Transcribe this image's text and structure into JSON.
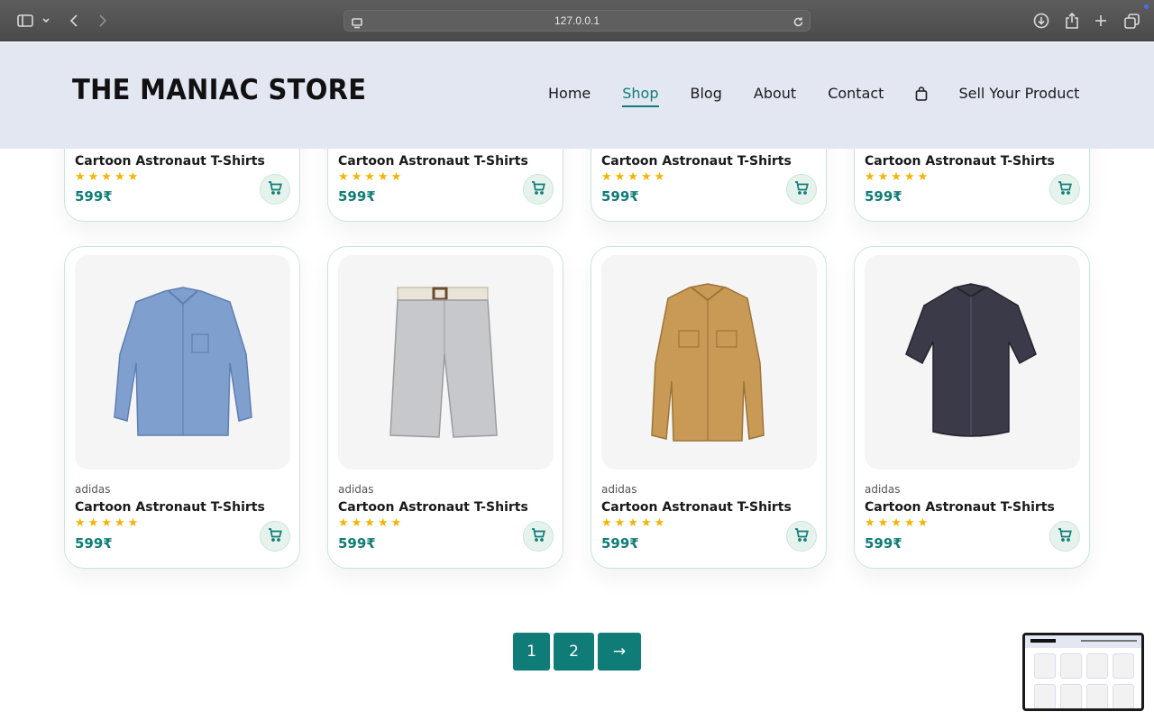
{
  "browser": {
    "url": "127.0.0.1",
    "icons": [
      "sidebar-toggle-icon",
      "chevron-down-icon",
      "back-arrow-icon",
      "forward-arrow-icon",
      "site-settings-icon",
      "reload-icon",
      "download-icon",
      "share-icon",
      "new-tab-plus-icon",
      "tab-overview-icon"
    ]
  },
  "header": {
    "logo": "THE MANIAC STORE",
    "nav": [
      {
        "label": "Home",
        "active": false
      },
      {
        "label": "Shop",
        "active": true
      },
      {
        "label": "Blog",
        "active": false
      },
      {
        "label": "About",
        "active": false
      },
      {
        "label": "Contact",
        "active": false
      },
      {
        "label": "Sell Your Product",
        "active": false
      }
    ],
    "cart_icon": "shopping-bag-icon"
  },
  "products_top_row": [
    {
      "name": "Cartoon Astronaut T-Shirts",
      "rating": 5,
      "price": "599₹"
    },
    {
      "name": "Cartoon Astronaut T-Shirts",
      "rating": 5,
      "price": "599₹"
    },
    {
      "name": "Cartoon Astronaut T-Shirts",
      "rating": 5,
      "price": "599₹"
    },
    {
      "name": "Cartoon Astronaut T-Shirts",
      "rating": 5,
      "price": "599₹"
    }
  ],
  "products": [
    {
      "brand": "adidas",
      "name": "Cartoon Astronaut T-Shirts",
      "rating": 5,
      "price": "599₹",
      "image": "blue-long-sleeve-shirt"
    },
    {
      "brand": "adidas",
      "name": "Cartoon Astronaut T-Shirts",
      "rating": 5,
      "price": "599₹",
      "image": "grey-striped-shorts"
    },
    {
      "brand": "adidas",
      "name": "Cartoon Astronaut T-Shirts",
      "rating": 5,
      "price": "599₹",
      "image": "tan-overshirt"
    },
    {
      "brand": "adidas",
      "name": "Cartoon Astronaut T-Shirts",
      "rating": 5,
      "price": "599₹",
      "image": "dark-short-sleeve-shirt"
    }
  ],
  "pagination": {
    "pages": [
      "1",
      "2"
    ],
    "next": "→"
  },
  "colors": {
    "accent": "#0f7c77",
    "header_bg": "#e3e7f2",
    "star": "#f4b400",
    "card_border": "#c9e6d9"
  }
}
